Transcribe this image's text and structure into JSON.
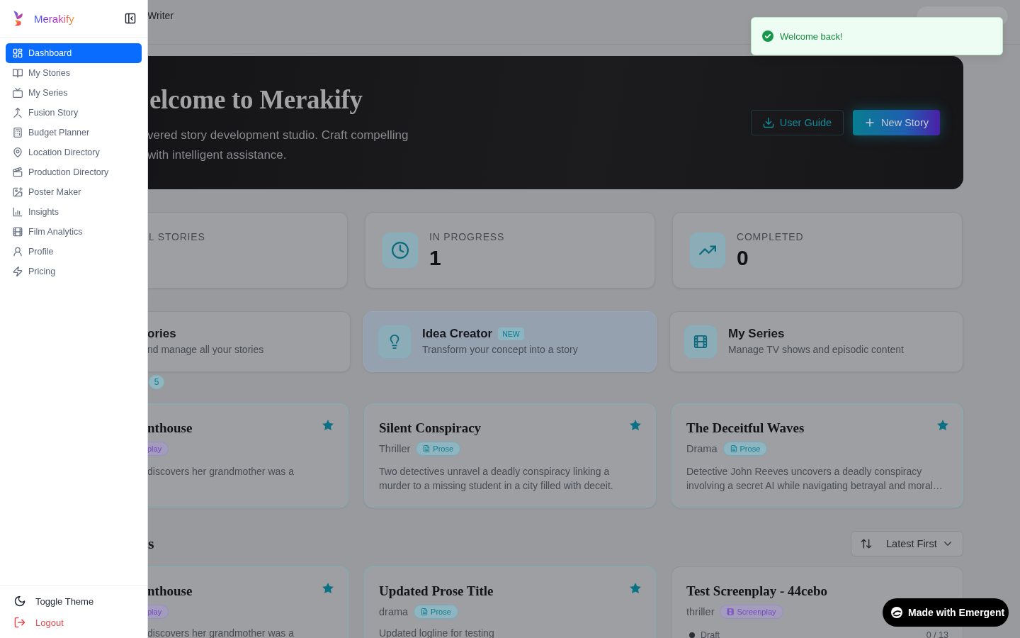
{
  "sidebar": {
    "brand": "Merakify",
    "nav": [
      {
        "label": "Dashboard",
        "selected": true
      },
      {
        "label": "My Stories",
        "selected": false
      },
      {
        "label": "My Series",
        "selected": false
      },
      {
        "label": "Fusion Story",
        "selected": false
      },
      {
        "label": "Budget Planner",
        "selected": false
      },
      {
        "label": "Location Directory",
        "selected": false
      },
      {
        "label": "Production Directory",
        "selected": false
      },
      {
        "label": "Poster Maker",
        "selected": false
      },
      {
        "label": "Insights",
        "selected": false
      },
      {
        "label": "Film Analytics",
        "selected": false
      },
      {
        "label": "Profile",
        "selected": false
      },
      {
        "label": "Pricing",
        "selected": false
      }
    ],
    "footer_actions": [
      {
        "label": "Toggle Theme",
        "kind": "default"
      },
      {
        "label": "Logout",
        "kind": "danger"
      }
    ]
  },
  "header": {
    "title": "Writer"
  },
  "toast": {
    "message": "Welcome back!"
  },
  "hero": {
    "title": "elcome to Merakify",
    "subtitle_lines": [
      "vered story development studio. Craft compelling",
      "with intelligent assistance."
    ],
    "buttons": [
      {
        "label": "User Guide",
        "kind": "outline"
      },
      {
        "label": "New Story",
        "kind": "primary"
      }
    ]
  },
  "stats": [
    {
      "label": "L STORIES"
    },
    {
      "label": "IN PROGRESS",
      "value": "1"
    },
    {
      "label": "COMPLETED",
      "value": "0"
    }
  ],
  "quick_actions": [
    {
      "title": "ories",
      "subtitle": "nd manage all your stories",
      "highlighted": false
    },
    {
      "title": "Idea Creator",
      "badge": "NEW",
      "subtitle": "Transform your concept into a story",
      "highlighted": true
    },
    {
      "title": "My Series",
      "subtitle": "Manage TV shows and episodic content",
      "highlighted": false
    }
  ],
  "story_count": "5",
  "featured_stories": [
    {
      "title": "nthouse",
      "format": {
        "label": "play",
        "kind": "screenplay"
      },
      "description": "discovers her grandmother was a",
      "starred": true
    },
    {
      "title": "Silent Conspiracy",
      "genre": "Thriller",
      "format": {
        "label": "Prose",
        "kind": "prose"
      },
      "description": "Two detectives unravel a deadly conspiracy linking a murder to a missing student in a city filled with deceit.",
      "starred": true
    },
    {
      "title": "The Deceitful Waves",
      "genre": "Drama",
      "format": {
        "label": "Prose",
        "kind": "prose"
      },
      "description": "Detective John Reeves uncovers a deadly conspiracy involving a secret AI while navigating betrayal and moral…",
      "starred": true
    }
  ],
  "library": {
    "heading": "s",
    "sort": {
      "value": "Latest First"
    },
    "stories": [
      {
        "title": "nthouse",
        "format": {
          "label": "play",
          "kind": "screenplay"
        },
        "description": "discovers her grandmother was a",
        "starred": true
      },
      {
        "title": "Updated Prose Title",
        "genre": "drama",
        "format": {
          "label": "Prose",
          "kind": "prose"
        },
        "description": "Updated logline for testing",
        "starred": true
      },
      {
        "title": "Test Screenplay - 44cebo",
        "genre": "thriller",
        "format": {
          "label": "Screenplay",
          "kind": "screenplay"
        },
        "status": "Draft",
        "progress": "0 / 13",
        "starred": false
      }
    ]
  },
  "promo_badge": {
    "label": "Made with Emergent"
  }
}
